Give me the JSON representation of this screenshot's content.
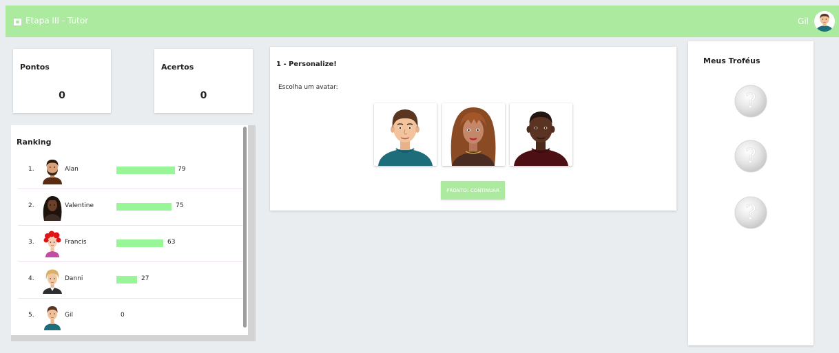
{
  "header": {
    "app_title": "Etapa III - Tutor",
    "user_name": "Gil",
    "icon": "app-icon",
    "brand_color": "#acea9f"
  },
  "stats": {
    "points": {
      "label": "Pontos",
      "value": "0"
    },
    "hits": {
      "label": "Acertos",
      "value": "0"
    }
  },
  "ranking": {
    "title": "Ranking",
    "entries": [
      {
        "position": "1.",
        "name": "Alan",
        "score": "79"
      },
      {
        "position": "2.",
        "name": "Valentine",
        "score": "75"
      },
      {
        "position": "3.",
        "name": "Francis",
        "score": "63"
      },
      {
        "position": "4.",
        "name": "Danni",
        "score": "27"
      },
      {
        "position": "5.",
        "name": "Gil",
        "score": "0"
      }
    ],
    "bar_color": "#98f598"
  },
  "task": {
    "title": "1 - Personalize!",
    "prompt": "Escolha um avatar:",
    "avatar_options": [
      "avatar-man-short-hair",
      "avatar-woman-long-hair",
      "avatar-man-dark-skin"
    ],
    "continue_label": "PRONTO! CONTINUAR"
  },
  "trophies": {
    "title": "Meus Troféus",
    "items": [
      "question-trophy-icon",
      "question-trophy-icon",
      "question-trophy-icon"
    ]
  }
}
